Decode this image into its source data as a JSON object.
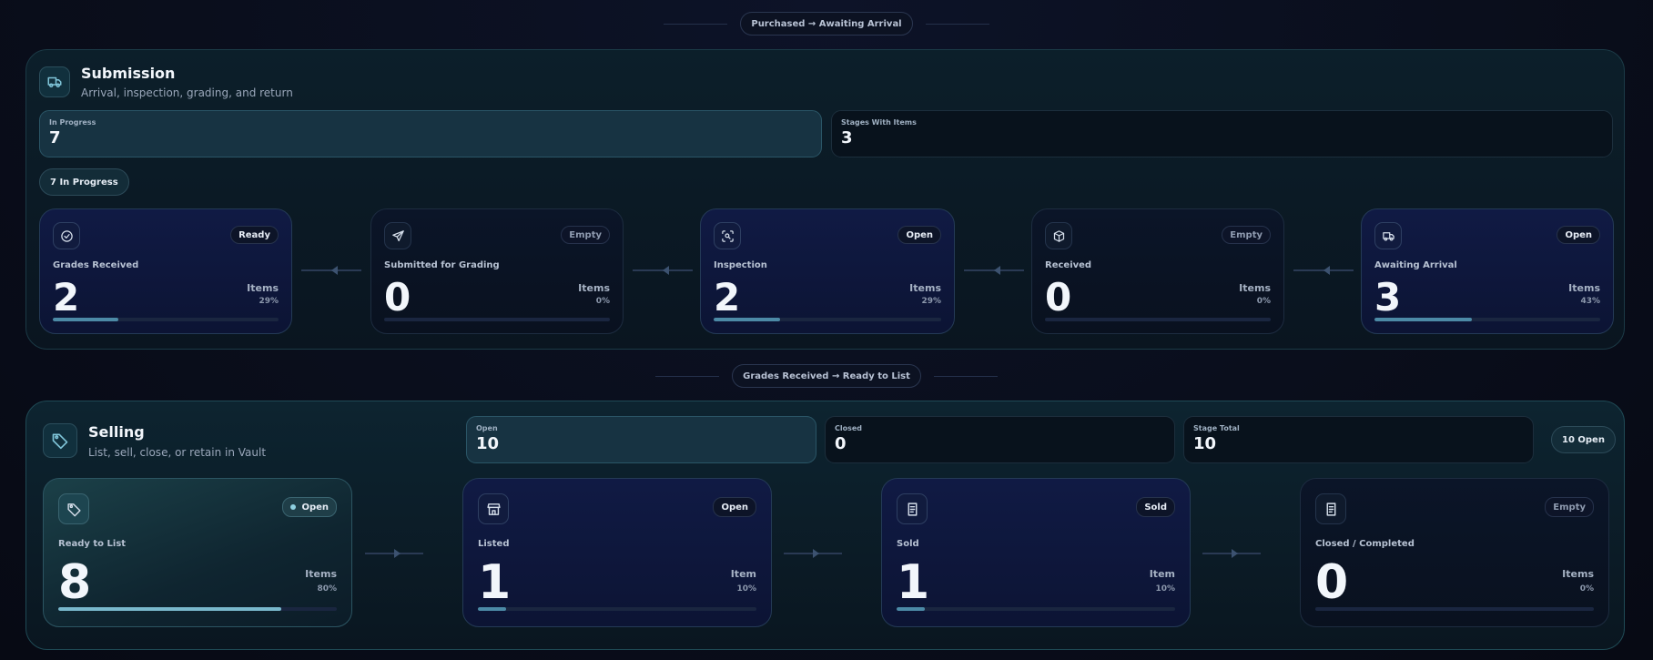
{
  "dividers": {
    "top": "Purchased → Awaiting Arrival",
    "middle": "Grades Received → Ready to List"
  },
  "submission": {
    "title": "Submission",
    "subtitle": "Arrival, inspection, grading, and return",
    "stats": [
      {
        "label": "In Progress",
        "value": "7"
      },
      {
        "label": "Stages With Items",
        "value": "3"
      }
    ],
    "badge": "7 In Progress",
    "cards": [
      {
        "icon": "check-circle-icon",
        "tag": "Ready",
        "label": "Grades Received",
        "count": "2",
        "unit": "Items",
        "pct": "29%",
        "fill": 0.29
      },
      {
        "icon": "send-icon",
        "tag": "Empty",
        "label": "Submitted for Grading",
        "count": "0",
        "unit": "Items",
        "pct": "0%",
        "fill": 0
      },
      {
        "icon": "scan-search-icon",
        "tag": "Open",
        "label": "Inspection",
        "count": "2",
        "unit": "Items",
        "pct": "29%",
        "fill": 0.29
      },
      {
        "icon": "package-icon",
        "tag": "Empty",
        "label": "Received",
        "count": "0",
        "unit": "Items",
        "pct": "0%",
        "fill": 0
      },
      {
        "icon": "truck-icon",
        "tag": "Open",
        "label": "Awaiting Arrival",
        "count": "3",
        "unit": "Items",
        "pct": "43%",
        "fill": 0.43
      }
    ]
  },
  "selling": {
    "title": "Selling",
    "subtitle": "List, sell, close, or retain in Vault",
    "stats": [
      {
        "label": "Open",
        "value": "10"
      },
      {
        "label": "Closed",
        "value": "0"
      },
      {
        "label": "Stage Total",
        "value": "10"
      }
    ],
    "badge": "10 Open",
    "cards": [
      {
        "icon": "tag-icon",
        "tag": "Open",
        "label": "Ready to List",
        "count": "8",
        "unit": "Items",
        "pct": "80%",
        "fill": 0.8
      },
      {
        "icon": "store-icon",
        "tag": "Open",
        "label": "Listed",
        "count": "1",
        "unit": "Item",
        "pct": "10%",
        "fill": 0.1
      },
      {
        "icon": "receipt-icon",
        "tag": "Sold",
        "label": "Sold",
        "count": "1",
        "unit": "Item",
        "pct": "10%",
        "fill": 0.1
      },
      {
        "icon": "receipt-icon",
        "tag": "Empty",
        "label": "Closed / Completed",
        "count": "0",
        "unit": "Items",
        "pct": "0%",
        "fill": 0
      }
    ]
  },
  "colors": {
    "accent": "#4c8aa6",
    "accent_light": "#79b8cc",
    "card_bg": "#101a44"
  }
}
